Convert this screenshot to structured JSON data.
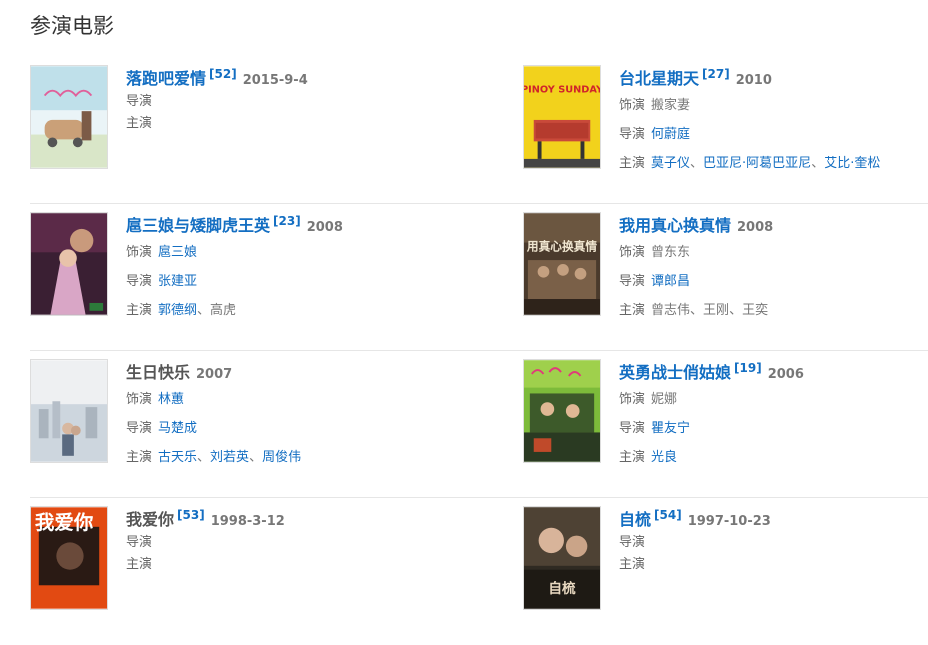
{
  "section_title": "参演电影",
  "films": [
    {
      "title": "落跑吧爱情",
      "ref": "[52]",
      "date": "2015-9-4",
      "role_label": "",
      "role": "",
      "director_label": "导演",
      "director": "",
      "cast_label": "主演",
      "cast": []
    },
    {
      "title": "台北星期天",
      "ref": "[27]",
      "date": "2010",
      "poster_text": "PINOY SUNDAY",
      "role_label": "饰演",
      "role": "搬家妻",
      "director_label": "导演",
      "director": "何蔚庭",
      "cast_label": "主演",
      "cast": [
        "莫子仪",
        "巴亚尼·阿葛巴亚尼",
        "艾比·奎松"
      ]
    },
    {
      "title": "扈三娘与矮脚虎王英",
      "ref": "[23]",
      "date": "2008",
      "role_label": "饰演",
      "role": "扈三娘",
      "director_label": "导演",
      "director": "张建亚",
      "cast_label": "主演",
      "cast": [
        "郭德纲",
        "高虎"
      ]
    },
    {
      "title": "我用真心换真情",
      "ref": "",
      "date": "2008",
      "poster_text": "用真心换真情",
      "role_label": "饰演",
      "role": "曾东东",
      "director_label": "导演",
      "director": "谭郎昌",
      "cast_label": "主演",
      "cast": [
        "曾志伟",
        "王刚",
        "王奕"
      ]
    },
    {
      "title": "生日快乐",
      "ref": "",
      "date": "2007",
      "role_label": "饰演",
      "role": "林蕙",
      "director_label": "导演",
      "director": "马楚成",
      "cast_label": "主演",
      "cast": [
        "古天乐",
        "刘若英",
        "周俊伟"
      ]
    },
    {
      "title": "英勇战士俏姑娘",
      "ref": "[19]",
      "date": "2006",
      "role_label": "饰演",
      "role": "妮娜",
      "director_label": "导演",
      "director": "瞿友宁",
      "cast_label": "主演",
      "cast": [
        "光良"
      ]
    },
    {
      "title": "我爱你",
      "ref": "[53]",
      "date": "1998-3-12",
      "poster_text": "我爱你",
      "role_label": "",
      "role": "",
      "director_label": "导演",
      "director": "",
      "cast_label": "主演",
      "cast": []
    },
    {
      "title": "自梳",
      "ref": "[54]",
      "date": "1997-10-23",
      "poster_text": "自梳",
      "role_label": "",
      "role": "",
      "director_label": "导演",
      "director": "",
      "cast_label": "主演",
      "cast": []
    }
  ],
  "colors": {
    "link": "#136ec2",
    "muted": "#777777",
    "divider": "#e6e6e6"
  }
}
